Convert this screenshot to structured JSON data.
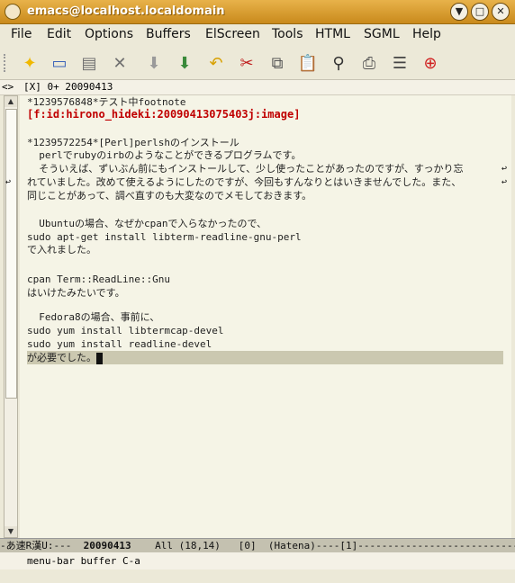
{
  "window": {
    "title": "emacs@localhost.localdomain",
    "minimize_glyph": "▼",
    "maximize_glyph": "□",
    "close_glyph": "✕"
  },
  "menubar": {
    "items": [
      "File",
      "Edit",
      "Options",
      "Buffers",
      "ElScreen",
      "Tools",
      "HTML",
      "SGML",
      "Help"
    ]
  },
  "toolbar": {
    "buttons": [
      {
        "icon": "new-file-icon",
        "glyph": "✦",
        "color": "#f0b800"
      },
      {
        "icon": "open-folder-icon",
        "glyph": "▭",
        "color": "#3a62b8"
      },
      {
        "icon": "save-icon",
        "glyph": "▤",
        "color": "#707070"
      },
      {
        "icon": "close-icon",
        "glyph": "✕",
        "color": "#707070"
      },
      {
        "icon": "save-as-icon",
        "glyph": "⬇",
        "color": "#9a9a9a"
      },
      {
        "icon": "download-icon",
        "glyph": "⬇",
        "color": "#3a8a3a"
      },
      {
        "icon": "undo-icon",
        "glyph": "↶",
        "color": "#d8a000"
      },
      {
        "icon": "cut-icon",
        "glyph": "✂",
        "color": "#c02020"
      },
      {
        "icon": "copy-icon",
        "glyph": "⧉",
        "color": "#555555"
      },
      {
        "icon": "paste-icon",
        "glyph": "📋",
        "color": "#8a6a30"
      },
      {
        "icon": "search-icon",
        "glyph": "⚲",
        "color": "#333333"
      },
      {
        "icon": "print-icon",
        "glyph": "⎙",
        "color": "#555555"
      },
      {
        "icon": "preferences-icon",
        "glyph": "☰",
        "color": "#444444"
      },
      {
        "icon": "help-icon",
        "glyph": "⊕",
        "color": "#d02020"
      }
    ]
  },
  "tabbar": {
    "arrows": "<>",
    "label": "[X] 0+ 20090413"
  },
  "editor": {
    "lines": [
      {
        "text": "*1239576848*テスト中footnote",
        "style": "normal"
      },
      {
        "text": "[f:id:hirono_hideki:20090413075403j:image]",
        "style": "heading"
      },
      {
        "text": "",
        "style": "normal"
      },
      {
        "text": "*1239572254*[Perl]perlshのインストール",
        "style": "normal"
      },
      {
        "text": "  perlでrubyのirbのようなことができるプログラムです。",
        "style": "normal"
      },
      {
        "text": "  そういえば、ずいぶん前にもインストールして、少し使ったことがあったのですが、すっかり忘",
        "style": "normal"
      },
      {
        "text": "れていました。改めて使えるようにしたのですが、今回もすんなりとはいきませんでした。また、",
        "style": "normal"
      },
      {
        "text": "同じことがあって、調べ直すのも大変なのでメモしておきます。",
        "style": "normal"
      },
      {
        "text": "",
        "style": "normal"
      },
      {
        "text": "  Ubuntuの場合、なぜかcpanで入らなかったので、",
        "style": "normal"
      },
      {
        "text": "sudo apt-get install libterm-readline-gnu-perl",
        "style": "normal"
      },
      {
        "text": "で入れました。",
        "style": "normal"
      },
      {
        "text": "",
        "style": "normal"
      },
      {
        "text": "cpan Term::ReadLine::Gnu",
        "style": "normal"
      },
      {
        "text": "はいけたみたいです。",
        "style": "normal"
      },
      {
        "text": "",
        "style": "normal"
      },
      {
        "text": "  Fedora8の場合、事前に、",
        "style": "normal"
      },
      {
        "text": "sudo yum install libtermcap-devel",
        "style": "normal"
      },
      {
        "text": "sudo yum install readline-devel",
        "style": "normal"
      },
      {
        "text": "が必要でした。",
        "style": "current"
      }
    ],
    "wrap_glyph": "↩"
  },
  "modeline": {
    "prefix": "-あ速R漢U:---  ",
    "buffer_name": "20090413",
    "suffix": "    All (18,14)   [0]  (Hatena)----[1]-----------------------------"
  },
  "minibuffer": {
    "text": "menu-bar buffer C-a"
  }
}
